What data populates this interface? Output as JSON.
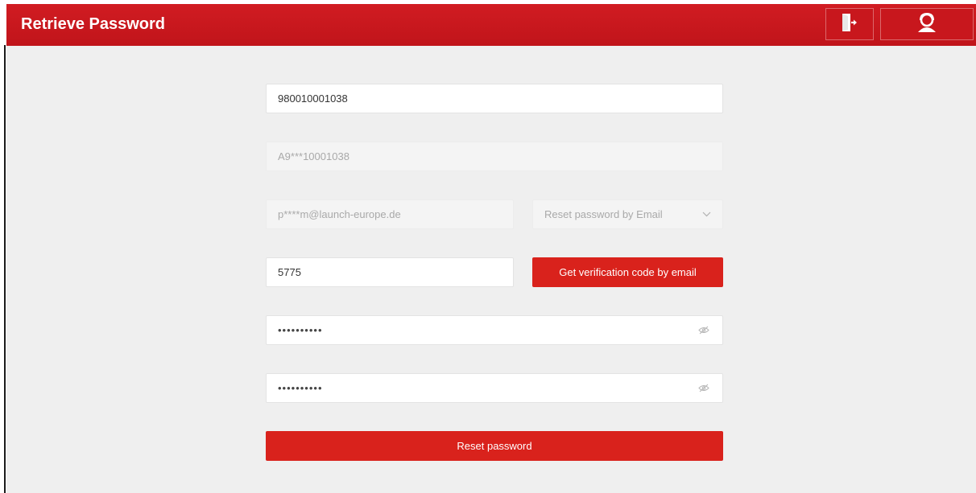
{
  "header": {
    "title": "Retrieve Password",
    "exit_icon": "exit-door-icon",
    "support_icon": "customer-support-icon"
  },
  "form": {
    "serial_number": {
      "value": "980010001038"
    },
    "masked_id": {
      "value": "A9***10001038"
    },
    "masked_email": {
      "value": "p****m@launch-europe.de"
    },
    "reset_method": {
      "selected": "Reset password by Email"
    },
    "verification_code": {
      "value": "5775"
    },
    "get_code_label": "Get verification code by email",
    "new_password": {
      "value": "••••••••••"
    },
    "confirm_password": {
      "value": "••••••••••"
    },
    "reset_label": "Reset password"
  },
  "colors": {
    "header_red": "#c8171d",
    "button_red": "#d9221c",
    "background": "#efefef"
  }
}
